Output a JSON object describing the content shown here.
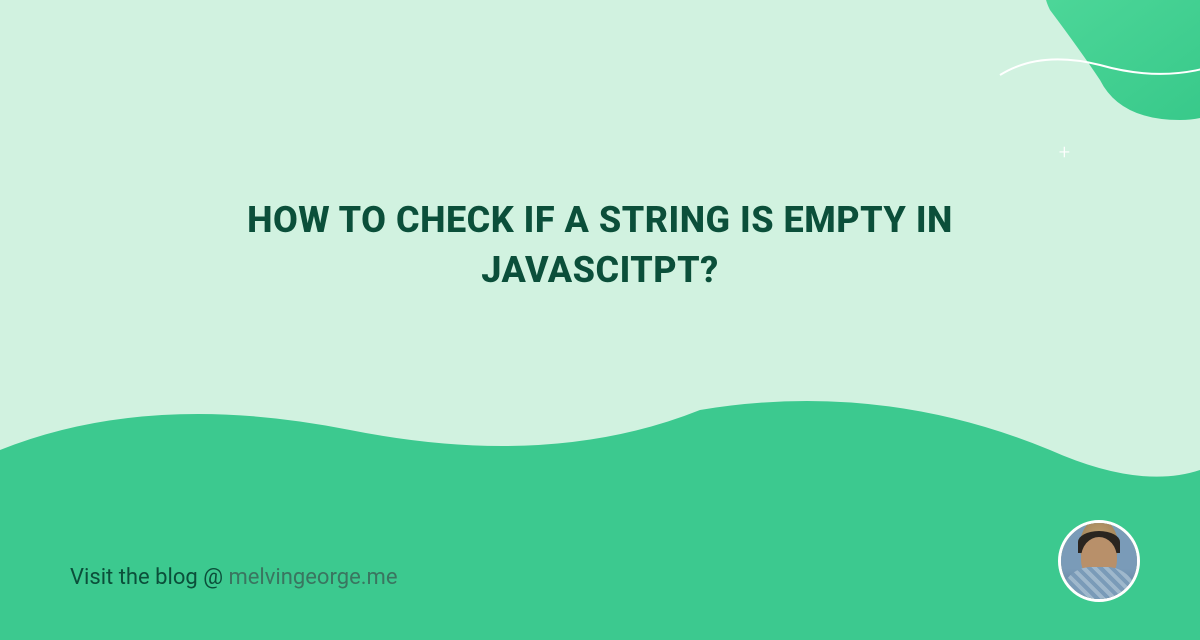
{
  "title": "HOW TO CHECK IF A STRING IS EMPTY IN JAVASCITPT?",
  "footer": {
    "prefix": "Visit the blog @ ",
    "domain": "melvingeorge.me"
  }
}
